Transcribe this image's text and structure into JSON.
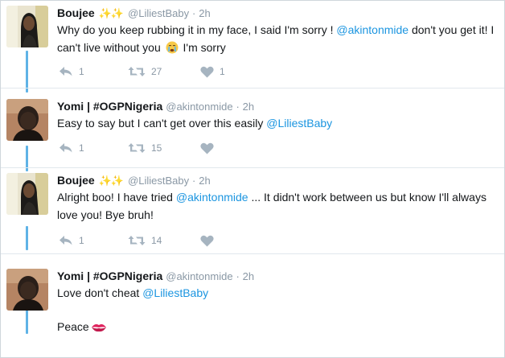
{
  "colors": {
    "thread_line": "#5fb3e6",
    "mention": "#1b95e0",
    "meta_gray": "#8a98a5",
    "action_gray": "#a6b4c0"
  },
  "tweets": [
    {
      "display_name": "Boujee",
      "sparkles": "✨✨",
      "handle": "@LiliestBaby",
      "separator": "·",
      "time": "2h",
      "text_1": "Why do you keep rubbing it in my face, I said I'm sorry ! ",
      "mention_1": "@akintonmide",
      "text_2": " don't you get it! I can't live without you ",
      "emoji": "crying-face-emoji",
      "text_3": " I'm sorry",
      "reply_count": "1",
      "retweet_count": "27",
      "like_count": "1"
    },
    {
      "display_name": "Yomi | #OGPNigeria",
      "handle": "@akintonmide",
      "separator": "·",
      "time": "2h",
      "text_1": "Easy to say  but I can't get over this easily ",
      "mention_1": "@LiliestBaby",
      "reply_count": "1",
      "retweet_count": "15",
      "like_count": ""
    },
    {
      "display_name": "Boujee",
      "sparkles": "✨✨",
      "handle": "@LiliestBaby",
      "separator": "·",
      "time": "2h",
      "text_1": "Alright boo! I have tried ",
      "mention_1": "@akintonmide",
      "text_2": " ... It didn't work between us but know I'll always love you! Bye bruh!",
      "reply_count": "1",
      "retweet_count": "14",
      "like_count": ""
    },
    {
      "display_name": "Yomi | #OGPNigeria",
      "handle": "@akintonmide",
      "separator": "·",
      "time": "2h",
      "text_1": "Love don't cheat ",
      "mention_1": "@LiliestBaby",
      "text_2": "Peace",
      "emoji": "kiss-mark-emoji"
    }
  ]
}
